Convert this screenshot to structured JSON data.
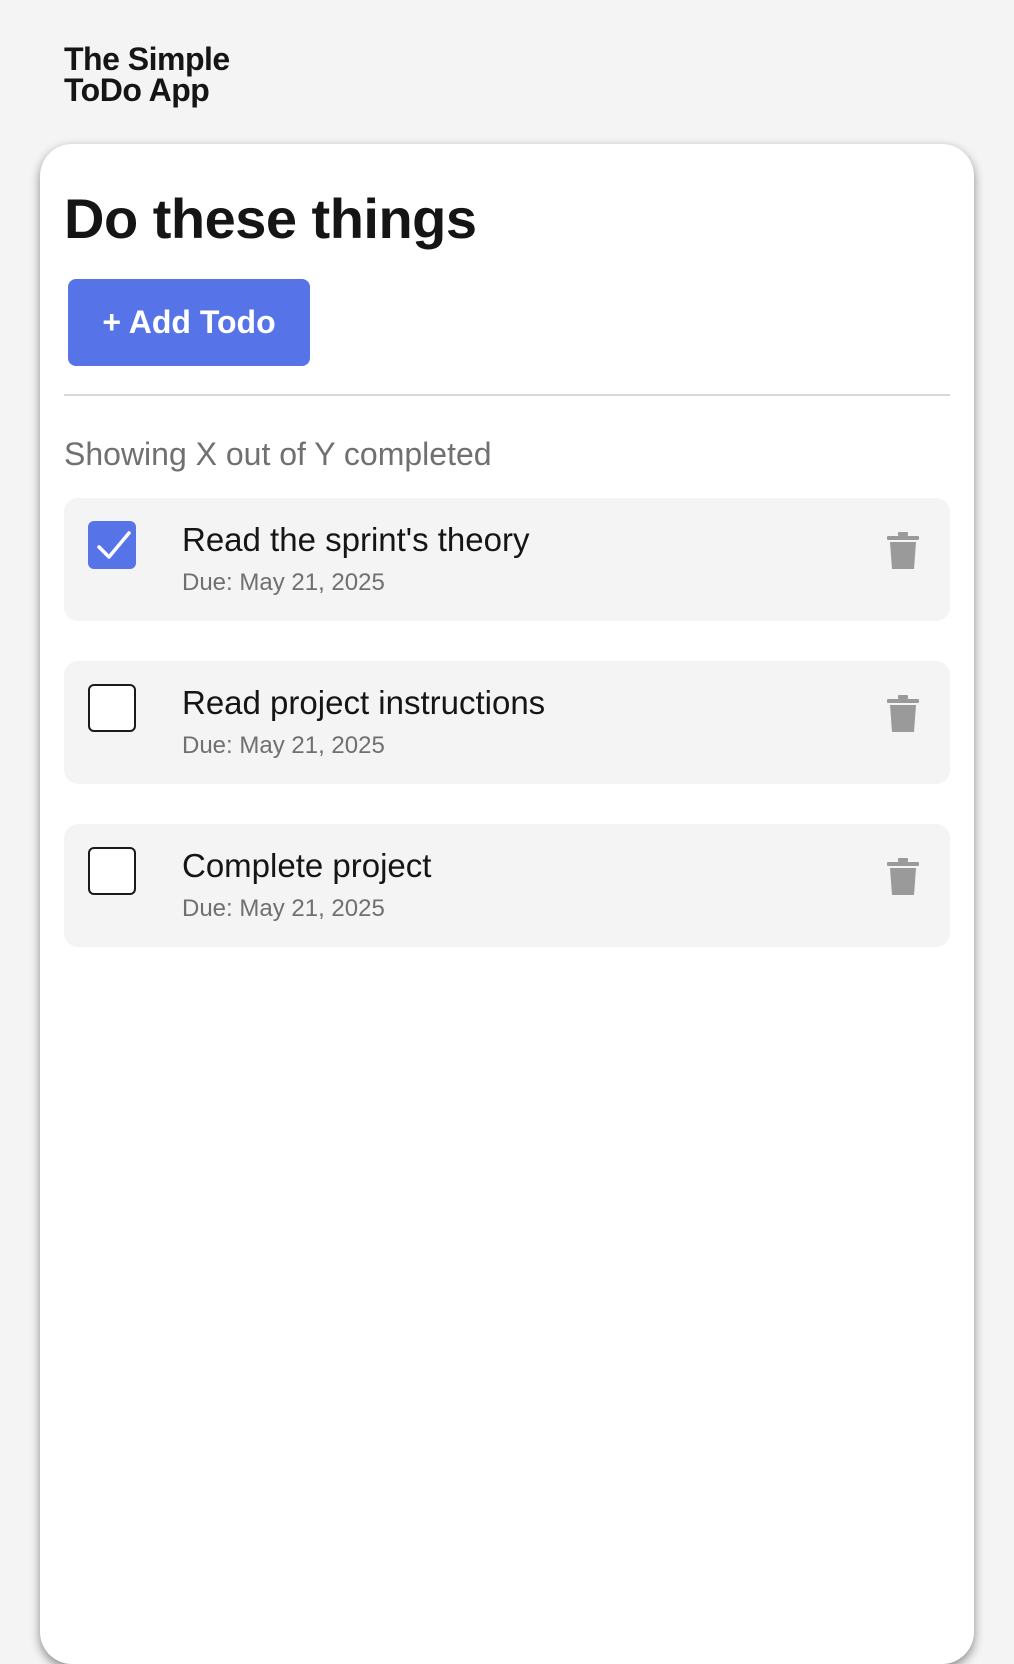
{
  "app": {
    "logo_line1": "The Simple",
    "logo_line2": "ToDo App"
  },
  "main": {
    "title": "Do these things",
    "add_button_label": "+ Add Todo",
    "status_text": "Showing X out of Y completed"
  },
  "todos": [
    {
      "title": "Read the sprint's theory",
      "due": "Due: May 21, 2025",
      "completed": true
    },
    {
      "title": "Read project instructions",
      "due": "Due: May 21, 2025",
      "completed": false
    },
    {
      "title": "Complete project",
      "due": "Due: May 21, 2025",
      "completed": false
    }
  ],
  "icons": {
    "checkbox_checked": "checkmark-icon",
    "delete": "trash-icon"
  },
  "colors": {
    "accent": "#5673e8",
    "background": "#f4f4f4",
    "card": "#ffffff",
    "text_primary": "#151515",
    "text_secondary": "#707070",
    "trash": "#9a9a9a"
  }
}
